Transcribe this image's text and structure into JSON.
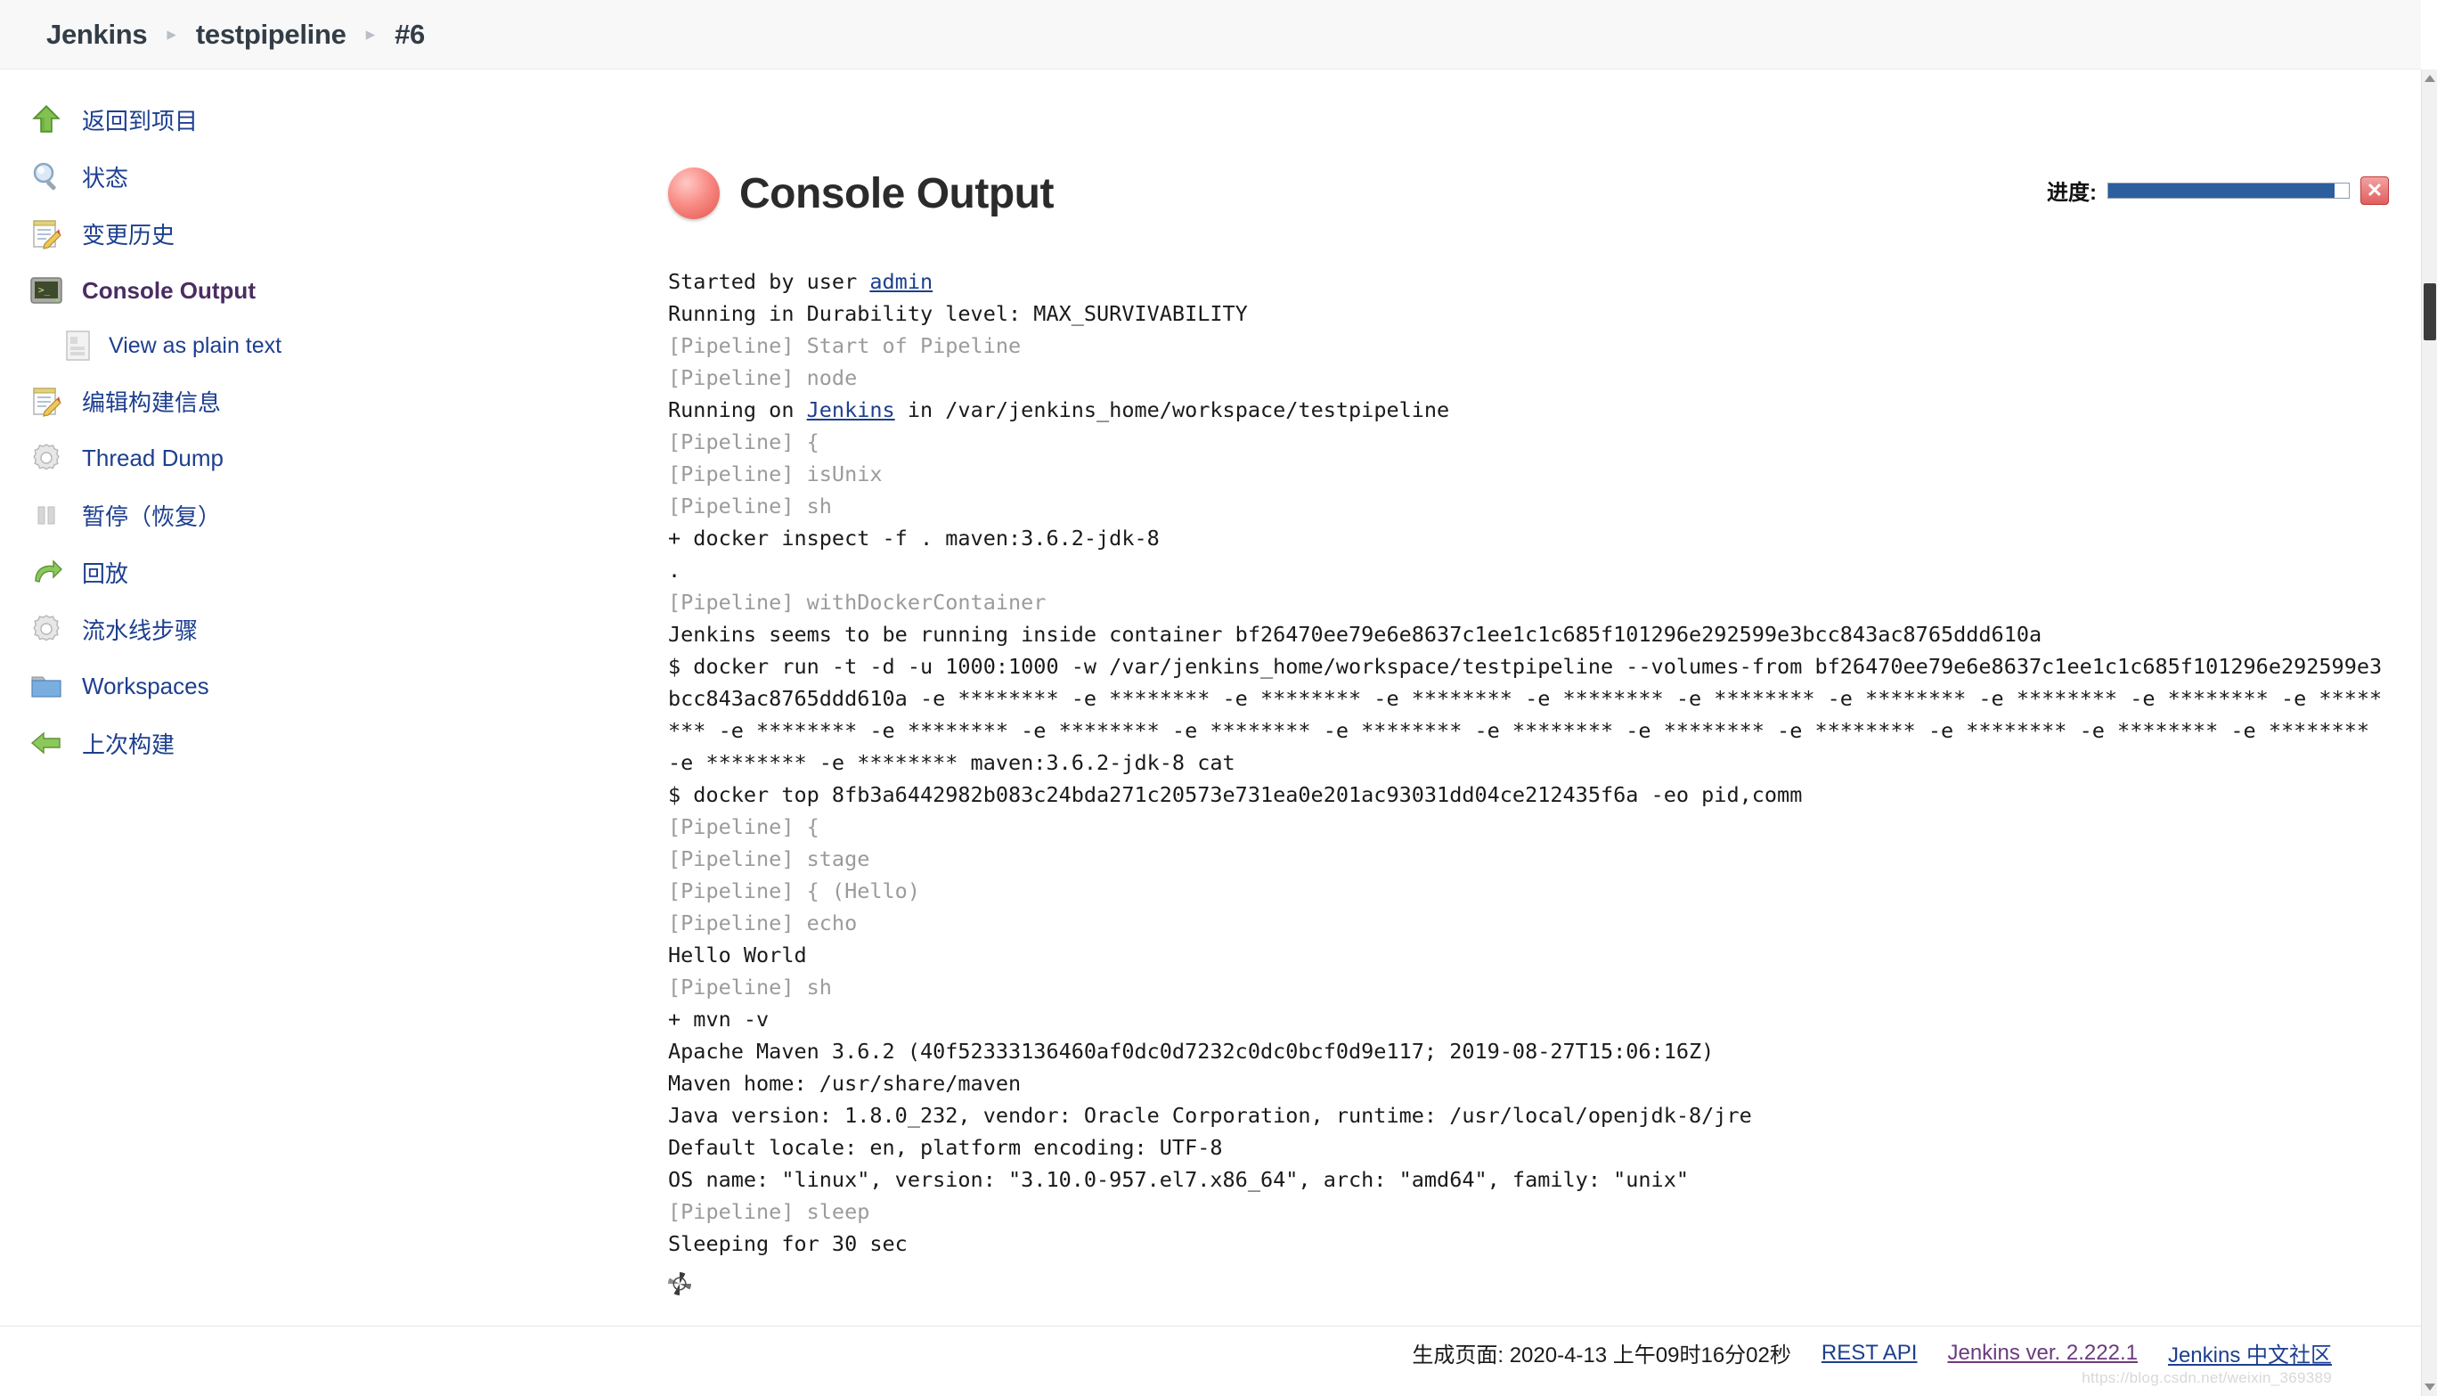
{
  "breadcrumb": {
    "items": [
      {
        "label": "Jenkins"
      },
      {
        "label": "testpipeline"
      },
      {
        "label": "#6"
      }
    ],
    "separator": "▸"
  },
  "sidebar": {
    "items": [
      {
        "label": "返回到项目",
        "icon": "green-up-arrow-icon",
        "active": false,
        "sub": false
      },
      {
        "label": "状态",
        "icon": "magnifier-icon",
        "active": false,
        "sub": false
      },
      {
        "label": "变更历史",
        "icon": "notepad-pencil-icon",
        "active": false,
        "sub": false
      },
      {
        "label": "Console Output",
        "icon": "terminal-icon",
        "active": true,
        "sub": false
      },
      {
        "label": "View as plain text",
        "icon": "document-icon",
        "active": false,
        "sub": true
      },
      {
        "label": "编辑构建信息",
        "icon": "notepad-pencil-icon",
        "active": false,
        "sub": false
      },
      {
        "label": "Thread Dump",
        "icon": "gear-icon",
        "active": false,
        "sub": false
      },
      {
        "label": "暂停（恢复）",
        "icon": "pause-icon",
        "active": false,
        "sub": false
      },
      {
        "label": "回放",
        "icon": "green-replay-arrow-icon",
        "active": false,
        "sub": false
      },
      {
        "label": "流水线步骤",
        "icon": "gear-icon",
        "active": false,
        "sub": false
      },
      {
        "label": "Workspaces",
        "icon": "folder-icon",
        "active": false,
        "sub": false
      },
      {
        "label": "上次构建",
        "icon": "green-left-arrow-icon",
        "active": false,
        "sub": false
      }
    ]
  },
  "main": {
    "title": "Console Output",
    "build_status_ball": "red-in-progress-ball",
    "progress": {
      "label": "进度:",
      "percent": 94,
      "stop_button": "✕"
    },
    "console_lines": [
      {
        "t": "Started by user ",
        "link": "admin",
        "style": "normal"
      },
      {
        "t": "Running in Durability level: MAX_SURVIVABILITY",
        "style": "normal"
      },
      {
        "t": "[Pipeline] Start of Pipeline",
        "style": "pipeline"
      },
      {
        "t": "[Pipeline] node",
        "style": "pipeline"
      },
      {
        "t": "Running on ",
        "link": "Jenkins",
        "t2": " in /var/jenkins_home/workspace/testpipeline",
        "style": "normal"
      },
      {
        "t": "[Pipeline] {",
        "style": "pipeline"
      },
      {
        "t": "[Pipeline] isUnix",
        "style": "pipeline"
      },
      {
        "t": "[Pipeline] sh",
        "style": "pipeline"
      },
      {
        "t": "+ docker inspect -f . maven:3.6.2-jdk-8",
        "style": "normal"
      },
      {
        "t": ".",
        "style": "normal"
      },
      {
        "t": "[Pipeline] withDockerContainer",
        "style": "pipeline"
      },
      {
        "t": "Jenkins seems to be running inside container bf26470ee79e6e8637c1ee1c1c685f101296e292599e3bcc843ac8765ddd610a",
        "style": "normal"
      },
      {
        "t": "$ docker run -t -d -u 1000:1000 -w /var/jenkins_home/workspace/testpipeline --volumes-from bf26470ee79e6e8637c1ee1c1c685f101296e292599e3bcc843ac8765ddd610a -e ******** -e ******** -e ******** -e ******** -e ******** -e ******** -e ******** -e ******** -e ******** -e ******** -e ******** -e ******** -e ******** -e ******** -e ******** -e ******** -e ******** -e ******** -e ******** -e ******** -e ******** -e ******** -e ******** maven:3.6.2-jdk-8 cat",
        "style": "normal"
      },
      {
        "t": "$ docker top 8fb3a6442982b083c24bda271c20573e731ea0e201ac93031dd04ce212435f6a -eo pid,comm",
        "style": "normal"
      },
      {
        "t": "[Pipeline] {",
        "style": "pipeline"
      },
      {
        "t": "[Pipeline] stage",
        "style": "pipeline"
      },
      {
        "t": "[Pipeline] { (Hello)",
        "style": "pipeline"
      },
      {
        "t": "[Pipeline] echo",
        "style": "pipeline"
      },
      {
        "t": "Hello World",
        "style": "normal"
      },
      {
        "t": "[Pipeline] sh",
        "style": "pipeline"
      },
      {
        "t": "+ mvn -v",
        "style": "normal"
      },
      {
        "t": "Apache Maven 3.6.2 (40f52333136460af0dc0d7232c0dc0bcf0d9e117; 2019-08-27T15:06:16Z)",
        "style": "normal"
      },
      {
        "t": "Maven home: /usr/share/maven",
        "style": "normal"
      },
      {
        "t": "Java version: 1.8.0_232, vendor: Oracle Corporation, runtime: /usr/local/openjdk-8/jre",
        "style": "normal"
      },
      {
        "t": "Default locale: en, platform encoding: UTF-8",
        "style": "normal"
      },
      {
        "t": "OS name: \"linux\", version: \"3.10.0-957.el7.x86_64\", arch: \"amd64\", family: \"unix\"",
        "style": "normal"
      },
      {
        "t": "[Pipeline] sleep",
        "style": "pipeline"
      },
      {
        "t": "Sleeping for 30 sec",
        "style": "normal"
      }
    ]
  },
  "footer": {
    "generated": "生成页面: 2020-4-13 上午09时16分02秒",
    "rest_api": "REST API",
    "version": "Jenkins ver. 2.222.1",
    "community": "Jenkins 中文社区",
    "watermark": "https://blog.csdn.net/weixin_369389"
  }
}
